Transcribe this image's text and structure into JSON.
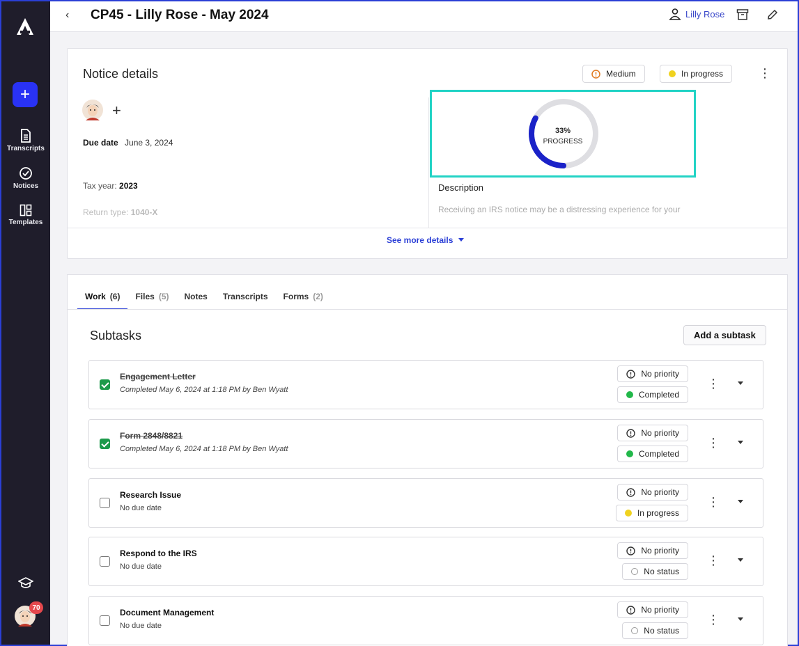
{
  "header": {
    "back_label": "‹",
    "title": "CP45 - Lilly Rose - May 2024",
    "assignee": "Lilly Rose",
    "icons": [
      "person-icon",
      "archive-icon",
      "pencil-icon"
    ]
  },
  "sidebar": {
    "add_label": "+",
    "items": [
      {
        "label": "Transcripts",
        "icon": "document-icon"
      },
      {
        "label": "Notices",
        "icon": "check-circle-icon"
      },
      {
        "label": "Templates",
        "icon": "layout-icon"
      }
    ],
    "notification_count": "70"
  },
  "notice": {
    "title": "Notice details",
    "priority": "Medium",
    "status": "In progress",
    "add_assignee_label": "+",
    "due_date_label": "Due date",
    "due_date_value": "June 3, 2024",
    "tax_year_label": "Tax year:",
    "tax_year_value": "2023",
    "return_type_label": "Return type:",
    "return_type_value": "1040-X",
    "progress_pct": "33%",
    "progress_label": "PROGRESS",
    "progress_fraction": 0.33,
    "description_title": "Description",
    "description_text": "Receiving an IRS notice may be a distressing experience for your",
    "see_more": "See more details"
  },
  "work": {
    "tabs": [
      {
        "label": "Work",
        "count": "(6)"
      },
      {
        "label": "Files",
        "count": "(5)"
      },
      {
        "label": "Notes",
        "count": ""
      },
      {
        "label": "Transcripts",
        "count": ""
      },
      {
        "label": "Forms",
        "count": "(2)"
      }
    ],
    "subtasks_title": "Subtasks",
    "add_subtask": "Add a subtask",
    "tasks": [
      {
        "name": "Engagement Letter",
        "sub": "Completed May 6, 2024 at 1:18 PM by Ben Wyatt",
        "priority": "No priority",
        "status": "Completed"
      },
      {
        "name": "Form 2848/8821",
        "sub": "Completed May 6, 2024 at 1:18 PM by Ben Wyatt",
        "priority": "No priority",
        "status": "Completed"
      },
      {
        "name": "Research Issue",
        "sub": "No due date",
        "priority": "No priority",
        "status": "In progress"
      },
      {
        "name": "Respond to the IRS",
        "sub": "No due date",
        "priority": "No priority",
        "status": "No status"
      },
      {
        "name": "Document Management",
        "sub": "No due date",
        "priority": "No priority",
        "status": "No status"
      }
    ]
  },
  "colors": {
    "accent": "#2b3fd6",
    "sidebar_bg": "#1f1d2b",
    "highlight": "#22d3c5",
    "completed": "#22b84a",
    "in_progress": "#f0d21f",
    "medium_priority": "#e07a1f",
    "progress_arc": "#1a22c8"
  }
}
